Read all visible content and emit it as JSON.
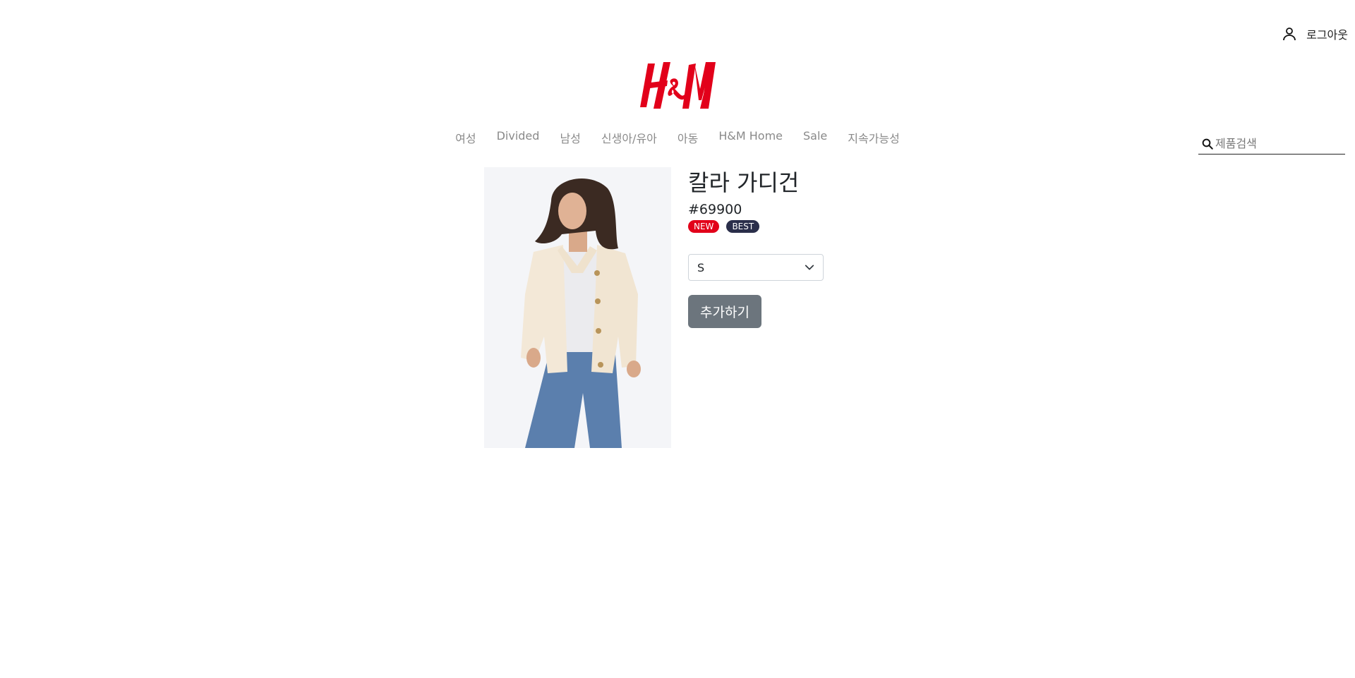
{
  "header": {
    "logout_label": "로그아웃",
    "logo_text": "H&M",
    "brand_color": "#e2001a"
  },
  "nav": {
    "items": [
      "여성",
      "Divided",
      "남성",
      "신생아/유아",
      "아동",
      "H&M Home",
      "Sale",
      "지속가능성"
    ]
  },
  "search": {
    "placeholder": "제품검색",
    "value": ""
  },
  "product": {
    "title": "칼라 가디건",
    "price": "#69900",
    "badges": [
      {
        "label": "NEW",
        "color": "#e2001a"
      },
      {
        "label": "BEST",
        "color": "#2a2e4a"
      }
    ],
    "size_selected": "S",
    "add_button_label": "추가하기",
    "button_color": "#6c757d"
  }
}
